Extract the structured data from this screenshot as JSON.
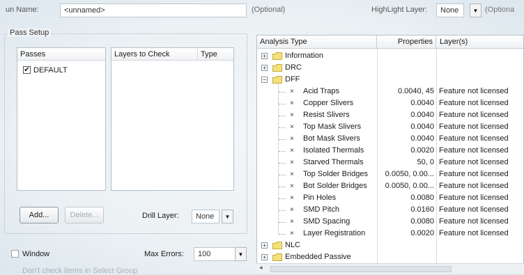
{
  "top": {
    "run_name_label": "un Name:",
    "run_name_value": "<unnamed>",
    "optional_hint": "(Optional)",
    "highlight_label": "HighLight Layer:",
    "highlight_value": "None",
    "highlight_hint": "(Optiona"
  },
  "pass_setup": {
    "title": "Pass Setup",
    "passes_header": "Passes",
    "passes": [
      {
        "label": "DEFAULT",
        "checked": true
      }
    ],
    "layers_header": "Layers to Check",
    "type_header": "Type",
    "add_label": "Add...",
    "delete_label": "Delete...",
    "drill_layer_label": "Drill Layer:",
    "drill_layer_value": "None"
  },
  "bottom": {
    "window_label": "Window",
    "max_errors_label": "Max Errors:",
    "max_errors_value": "100",
    "dont_check_label": "Don't check items in Select Group"
  },
  "analysis": {
    "headers": {
      "type": "Analysis Type",
      "properties": "Properties",
      "layers": "Layer(s)"
    },
    "rows": [
      {
        "kind": "group",
        "expanded": false,
        "label": "Information",
        "props": "",
        "layers": ""
      },
      {
        "kind": "group",
        "expanded": false,
        "label": "DRC",
        "props": "",
        "layers": ""
      },
      {
        "kind": "group",
        "expanded": true,
        "label": "DFF",
        "props": "",
        "layers": ""
      },
      {
        "kind": "item",
        "label": "Acid Traps",
        "props": "0.0040, 45",
        "layers": "Feature not licensed"
      },
      {
        "kind": "item",
        "label": "Copper Slivers",
        "props": "0.0040",
        "layers": "Feature not licensed"
      },
      {
        "kind": "item",
        "label": "Resist Slivers",
        "props": "0.0040",
        "layers": "Feature not licensed"
      },
      {
        "kind": "item",
        "label": "Top Mask Slivers",
        "props": "0.0040",
        "layers": "Feature not licensed"
      },
      {
        "kind": "item",
        "label": "Bot Mask Slivers",
        "props": "0.0040",
        "layers": "Feature not licensed"
      },
      {
        "kind": "item",
        "label": "Isolated Thermals",
        "props": "0.0020",
        "layers": "Feature not licensed"
      },
      {
        "kind": "item",
        "label": "Starved Thermals",
        "props": "50, 0",
        "layers": "Feature not licensed"
      },
      {
        "kind": "item",
        "label": "Top Solder Bridges",
        "props": "0.0050, 0.00...",
        "layers": "Feature not licensed"
      },
      {
        "kind": "item",
        "label": "Bot Solder Bridges",
        "props": "0.0050, 0.00...",
        "layers": "Feature not licensed"
      },
      {
        "kind": "item",
        "label": "Pin Holes",
        "props": "0.0080",
        "layers": "Feature not licensed"
      },
      {
        "kind": "item",
        "label": "SMD Pitch",
        "props": "0.0160",
        "layers": "Feature not licensed"
      },
      {
        "kind": "item",
        "label": "SMD Spacing",
        "props": "0.0080",
        "layers": "Feature not licensed"
      },
      {
        "kind": "item",
        "label": "Layer Registration",
        "props": "0.0020",
        "layers": "Feature not licensed"
      },
      {
        "kind": "group",
        "expanded": false,
        "label": "NLC",
        "props": "",
        "layers": ""
      },
      {
        "kind": "group",
        "expanded": false,
        "label": "Embedded Passive",
        "props": "",
        "layers": ""
      }
    ]
  },
  "colors": {
    "folder": "#f3e27a",
    "folder_edge": "#c9a93a"
  },
  "icons": {
    "expand": "plus-box-icon",
    "collapse": "minus-box-icon",
    "folder": "folder-icon",
    "item": "x-mark-icon"
  }
}
